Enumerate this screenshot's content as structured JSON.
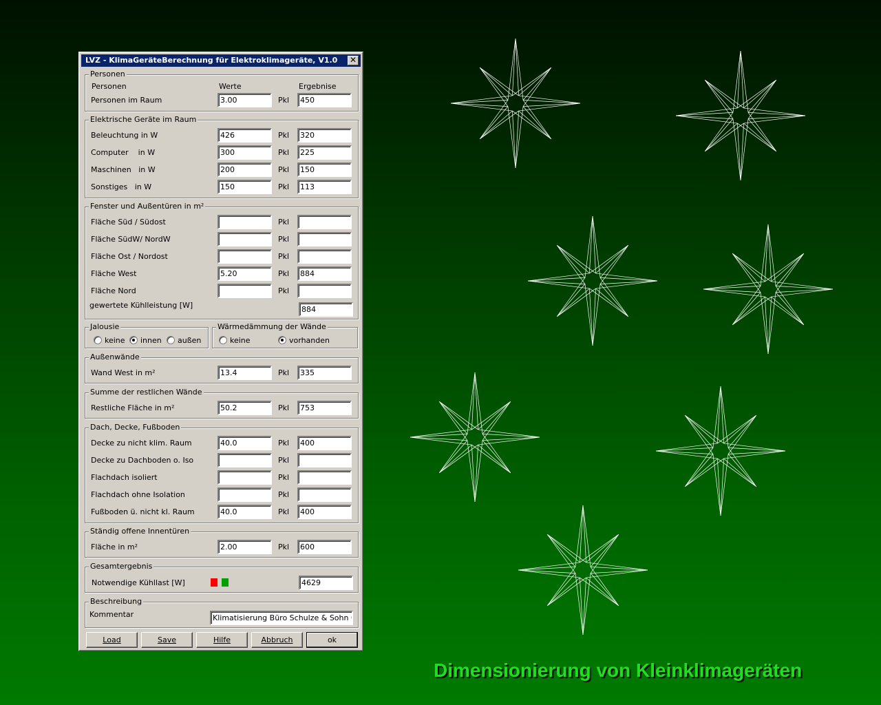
{
  "slide_title": "Dimensionierung von Kleinklimageräten",
  "window": {
    "title": "LVZ - KlimaGeräteBerechnung für Elektroklimageräte, V1.0",
    "close": "✕"
  },
  "unit": "Pkl",
  "personen": {
    "legend": "Personen",
    "col1": "Personen",
    "col2": "Werte",
    "col3": "Ergebnise",
    "row": {
      "label": "Personen im Raum",
      "value": "3.00",
      "result": "450"
    }
  },
  "geraete": {
    "legend": "Elektrische Geräte im Raum",
    "rows": [
      {
        "label": "Beleuchtung in W",
        "value": "426",
        "result": "320"
      },
      {
        "label": "Computer    in W",
        "value": "300",
        "result": "225"
      },
      {
        "label": "Maschinen   in W",
        "value": "200",
        "result": "150"
      },
      {
        "label": "Sonstiges   in W",
        "value": "150",
        "result": "113"
      }
    ]
  },
  "fenster": {
    "legend": "Fenster und Außentüren in m²",
    "rows": [
      {
        "label": "Fläche Süd / Südost",
        "value": "",
        "result": ""
      },
      {
        "label": "Fläche SüdW/ NordW",
        "value": "",
        "result": ""
      },
      {
        "label": "Fläche Ost / Nordost",
        "value": "",
        "result": ""
      },
      {
        "label": "Fläche West",
        "value": "5.20",
        "result": "884"
      },
      {
        "label": "Fläche Nord",
        "value": "",
        "result": ""
      }
    ],
    "total_label": "gewertete Kühlleistung [W]",
    "total_value": "884"
  },
  "jalousie": {
    "legend": "Jalousie",
    "options": [
      {
        "label": "keine",
        "selected": false
      },
      {
        "label": "innen",
        "selected": true
      },
      {
        "label": "außen",
        "selected": false
      }
    ]
  },
  "daemmung": {
    "legend": "Wärmedämmung der Wände",
    "options": [
      {
        "label": "keine",
        "selected": false
      },
      {
        "label": "vorhanden",
        "selected": true
      }
    ]
  },
  "aussenwaende": {
    "legend": "Außenwände",
    "row": {
      "label": "Wand West in m²",
      "value": "13.4",
      "result": "335"
    }
  },
  "restwaende": {
    "legend": "Summe der restlichen Wände",
    "row": {
      "label": "Restliche Fläche in m²",
      "value": "50.2",
      "result": "753"
    }
  },
  "dach": {
    "legend": "Dach, Decke, Fußboden",
    "rows": [
      {
        "label": "Decke zu nicht klim. Raum",
        "value": "40.0",
        "result": "400"
      },
      {
        "label": "Decke zu Dachboden o. Iso",
        "value": "",
        "result": ""
      },
      {
        "label": "Flachdach isoliert",
        "value": "",
        "result": ""
      },
      {
        "label": "Flachdach ohne Isolation",
        "value": "",
        "result": ""
      },
      {
        "label": "Fußboden ü. nicht kl. Raum",
        "value": "40.0",
        "result": "400"
      }
    ]
  },
  "innentueren": {
    "legend": "Ständig offene Innentüren",
    "row": {
      "label": "Fläche in m²",
      "value": "2.00",
      "result": "600"
    }
  },
  "gesamt": {
    "legend": "Gesamtergebnis",
    "label": "Notwendige Kühllast [W]",
    "value": "4629",
    "indicator_colors": [
      "#ff0000",
      "#00a000"
    ]
  },
  "beschreibung": {
    "legend": "Beschreibung",
    "label": "Kommentar",
    "value": "Klimatisierung Büro Schulze & Sohn GmbH"
  },
  "buttons": {
    "load": "Load",
    "save": "Save",
    "hilfe": "Hilfe",
    "abbruch": "Abbruch",
    "ok": "ok"
  }
}
